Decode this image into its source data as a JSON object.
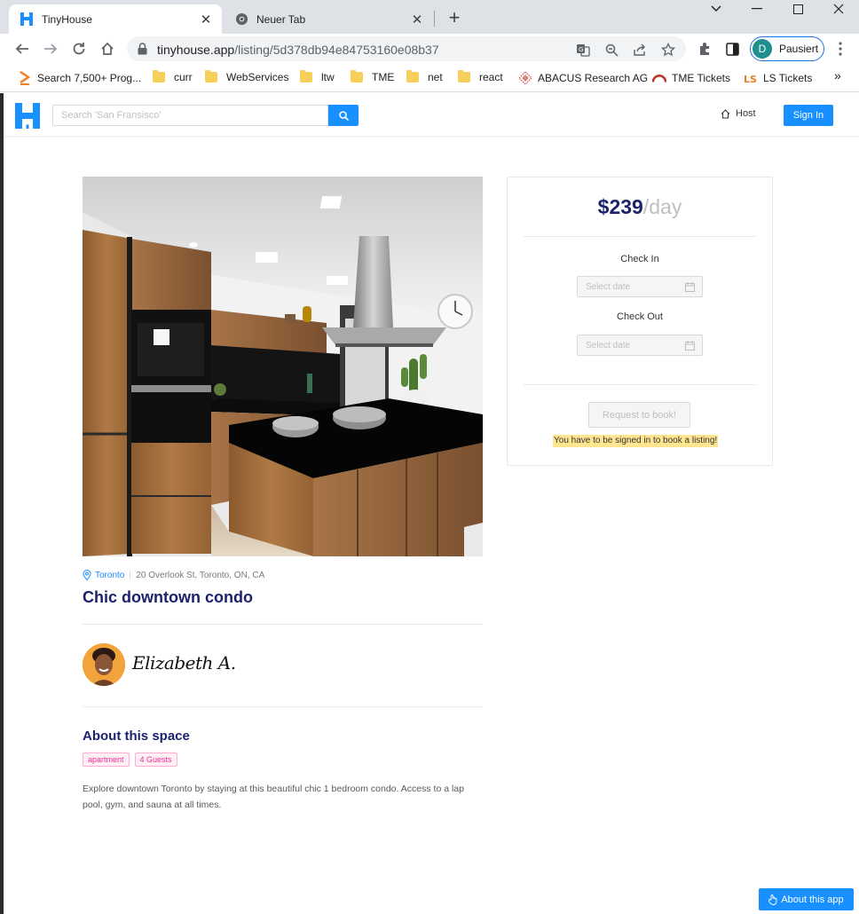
{
  "browser": {
    "tabs": [
      {
        "title": "TinyHouse",
        "active": true
      },
      {
        "title": "Neuer Tab",
        "active": false
      }
    ],
    "url_host": "tinyhouse.app",
    "url_path": "/listing/5d378db94e84753160e08b37",
    "profile_initial": "D",
    "profile_label": "Pausiert",
    "bookmarks": [
      {
        "label": "Search 7,500+ Prog...",
        "icon": "chevron-bookmark-icon"
      },
      {
        "label": "curr",
        "icon": "folder-icon"
      },
      {
        "label": "WebServices",
        "icon": "folder-icon"
      },
      {
        "label": "ltw",
        "icon": "folder-icon"
      },
      {
        "label": "TME",
        "icon": "folder-icon"
      },
      {
        "label": "net",
        "icon": "folder-icon"
      },
      {
        "label": "react",
        "icon": "folder-icon"
      },
      {
        "label": "ABACUS Research AG",
        "icon": "abacus-icon"
      },
      {
        "label": "TME Tickets",
        "icon": "tme-tickets-icon"
      },
      {
        "label": "LS Tickets",
        "icon": "ls-tickets-icon"
      }
    ],
    "more_bookmarks": "»"
  },
  "app": {
    "search_placeholder": "Search 'San Fransisco'",
    "host_label": "Host",
    "signin_label": "Sign In",
    "brand_color": "#1890ff",
    "title_color": "#1d226c"
  },
  "listing": {
    "city": "Toronto",
    "address": "20 Overlook St, Toronto, ON, CA",
    "title": "Chic downtown condo",
    "host_name": "Elizabeth A.",
    "about_title": "About this space",
    "tags": [
      "apartment",
      "4 Guests"
    ],
    "description": "Explore downtown Toronto by staying at this beautiful chic 1 bedroom condo. Access to a lap pool, gym, and sauna at all times."
  },
  "booking": {
    "price": "$239",
    "unit": "/day",
    "check_in_label": "Check In",
    "check_out_label": "Check Out",
    "date_placeholder": "Select date",
    "request_label": "Request to book!",
    "warning": "You have to be signed in to book a listing!"
  },
  "about_app_label": "About this app"
}
